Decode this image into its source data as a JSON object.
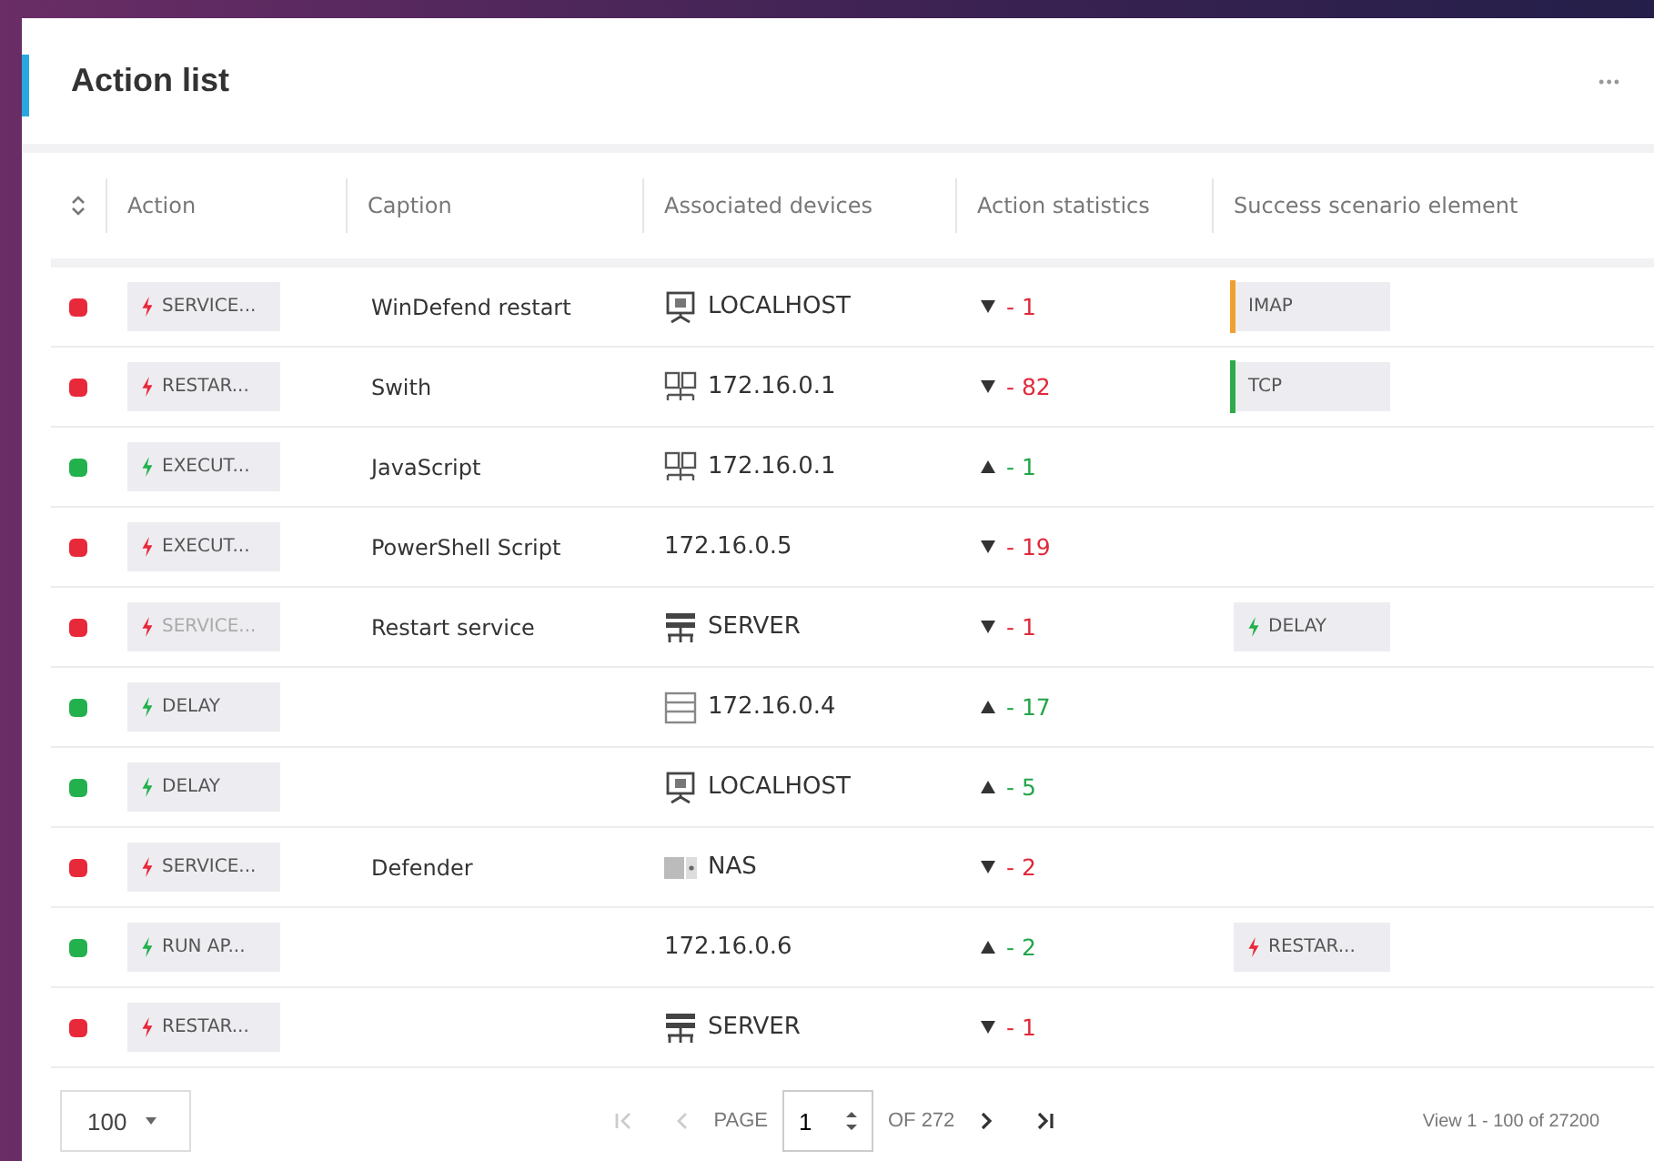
{
  "panel": {
    "title": "Action list",
    "menu": "•••"
  },
  "table": {
    "columns": [
      "Action",
      "Caption",
      "Associated devices",
      "Action statistics",
      "Success scenario element"
    ],
    "rows": [
      {
        "color": "#e8293a",
        "action": "SERVICE...",
        "action_faded": false,
        "caption": "WinDefend restart",
        "device": {
          "kind": "monitor",
          "text": "LOCALHOST"
        },
        "rising": false,
        "stat": "- 1",
        "success": {
          "kind": "bar",
          "color": "#f0a030",
          "text": "IMAP"
        }
      },
      {
        "color": "#e8293a",
        "action": "RESTAR...",
        "action_faded": false,
        "caption": "Swith",
        "device": {
          "kind": "switch",
          "text": "172.16.0.1"
        },
        "rising": false,
        "stat": "- 82",
        "success": {
          "kind": "bar",
          "color": "#2eaa4a",
          "text": "TCP"
        }
      },
      {
        "color": "#22b14c",
        "action": "EXECUT...",
        "action_faded": false,
        "caption": "JavaScript",
        "device": {
          "kind": "switch",
          "text": "172.16.0.1"
        },
        "rising": true,
        "stat": "- 1"
      },
      {
        "color": "#e8293a",
        "action": "EXECUT...",
        "action_faded": false,
        "caption": "PowerShell Script",
        "device": {
          "kind": "none",
          "text": "172.16.0.5"
        },
        "rising": false,
        "stat": "- 19"
      },
      {
        "color": "#e8293a",
        "action": "SERVICE...",
        "action_faded": true,
        "caption": "Restart service",
        "device": {
          "kind": "server",
          "text": "SERVER"
        },
        "rising": false,
        "stat": "- 1",
        "success": {
          "kind": "action",
          "color": "#22b14c",
          "text": "DELAY"
        }
      },
      {
        "color": "#22b14c",
        "action": "DELAY",
        "action_faded": false,
        "device": {
          "kind": "rack",
          "text": "172.16.0.4"
        },
        "rising": true,
        "stat": "- 17"
      },
      {
        "color": "#22b14c",
        "action": "DELAY",
        "action_faded": false,
        "device": {
          "kind": "monitor",
          "text": "LOCALHOST"
        },
        "rising": true,
        "stat": "- 5"
      },
      {
        "color": "#e8293a",
        "action": "SERVICE...",
        "action_faded": false,
        "caption": "Defender",
        "device": {
          "kind": "nas",
          "text": "NAS"
        },
        "rising": false,
        "stat": "- 2"
      },
      {
        "color": "#22b14c",
        "action": "RUN AP...",
        "action_faded": false,
        "device": {
          "kind": "none",
          "text": "172.16.0.6"
        },
        "rising": true,
        "stat": "- 2",
        "success": {
          "kind": "action",
          "color": "#e8293a",
          "text": "RESTAR..."
        }
      },
      {
        "color": "#e8293a",
        "action": "RESTAR...",
        "action_faded": false,
        "device": {
          "kind": "server",
          "text": "SERVER"
        },
        "rising": false,
        "stat": "- 1"
      }
    ]
  },
  "pager": {
    "page_size": "100",
    "page_label": "PAGE",
    "page": "1",
    "of": "OF 272",
    "summary": "View 1 - 100 of 27200"
  }
}
